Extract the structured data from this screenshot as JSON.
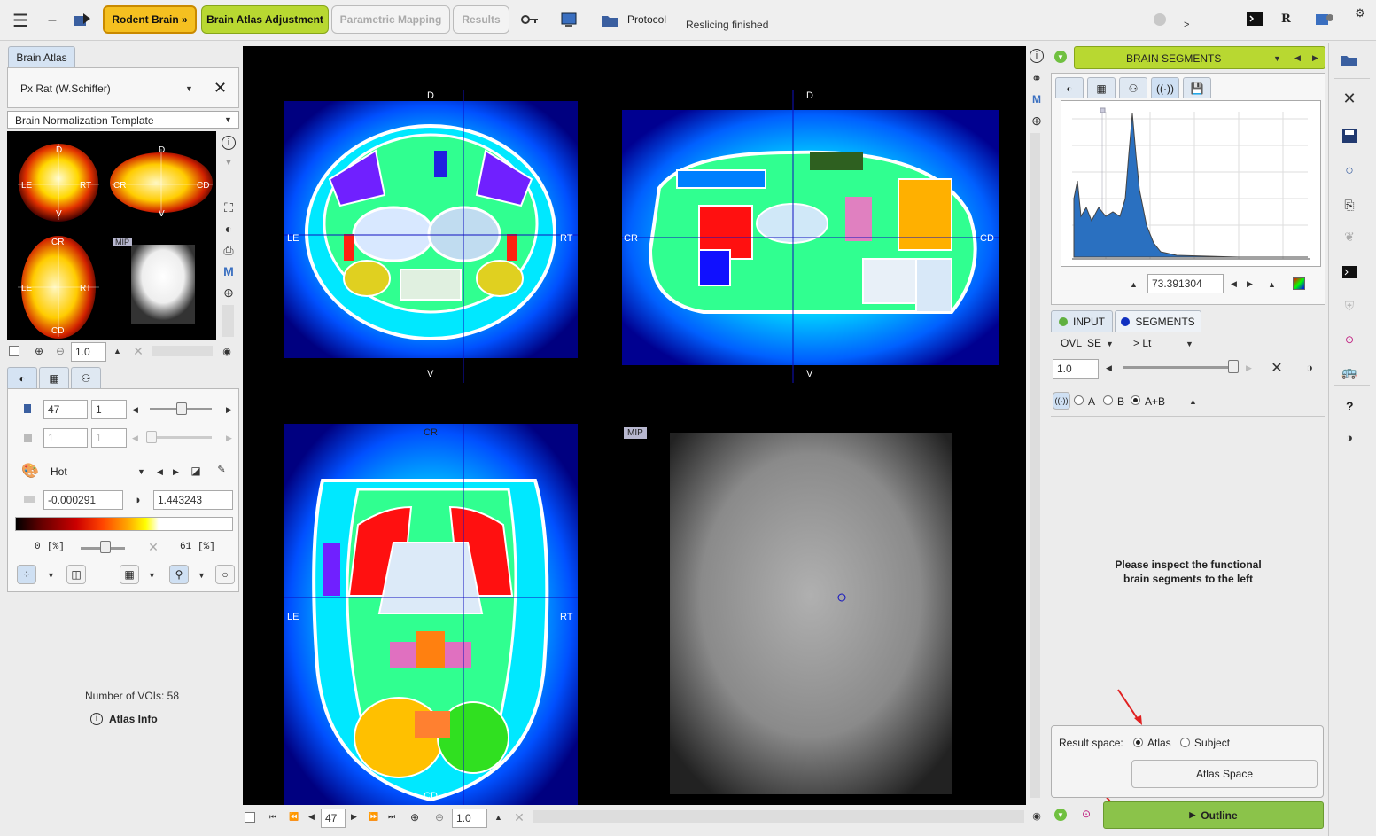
{
  "toolbar": {
    "rodent_brain": "Rodent Brain »",
    "brain_atlas_adjustment": "Brain Atlas Adjustment",
    "parametric_mapping": "Parametric Mapping",
    "results": "Results",
    "protocol": "Protocol",
    "status": "Reslicing finished",
    "r_label": "R",
    "prompt": ">"
  },
  "left": {
    "tab": "Brain Atlas",
    "atlas_select": "Px Rat (W.Schiffer)",
    "template_select": "Brain Normalization Template",
    "thumb_labels": {
      "d": "D",
      "v": "V",
      "le": "LE",
      "rt": "RT",
      "cr": "CR",
      "cd": "CD",
      "mip": "MIP"
    },
    "zoom_value": "1.0",
    "slice_value": "47",
    "slice_step": "1",
    "frame_value": "1",
    "frame_step": "1",
    "colormap": "Hot",
    "min_value": "-0.000291",
    "max_value": "1.443243",
    "pct_low": "0",
    "pct_low_unit": "[%]",
    "pct_high": "61",
    "pct_high_unit": "[%]",
    "voi_count": "Number of VOIs: 58",
    "atlas_info": "Atlas Info"
  },
  "center": {
    "labels": {
      "d": "D",
      "v": "V",
      "le": "LE",
      "rt": "RT",
      "cr": "CR",
      "cd": "CD",
      "mip": "MIP"
    },
    "slice_value": "47",
    "zoom_value": "1.0"
  },
  "right": {
    "header": "BRAIN SEGMENTS",
    "hist_value": "73.391304",
    "input_tab": "INPUT",
    "segments_tab": "SEGMENTS",
    "ovl": "OVL",
    "se": "SE",
    "lt": "> Lt",
    "blend_value": "1.0",
    "opt_a": "A",
    "opt_b": "B",
    "opt_ab": "A+B",
    "message_line1": "Please inspect the functional",
    "message_line2": "brain segments to the left",
    "result_space_label": "Result space:",
    "atlas_opt": "Atlas",
    "subject_opt": "Subject",
    "atlas_space_button": "Atlas Space",
    "outline_button": "Outline",
    "help": "?"
  },
  "colors": {
    "accent_orange": "#f5c020",
    "accent_green": "#b8d831",
    "outline_green": "#8bc34a",
    "crosshair": "#1010c0"
  }
}
